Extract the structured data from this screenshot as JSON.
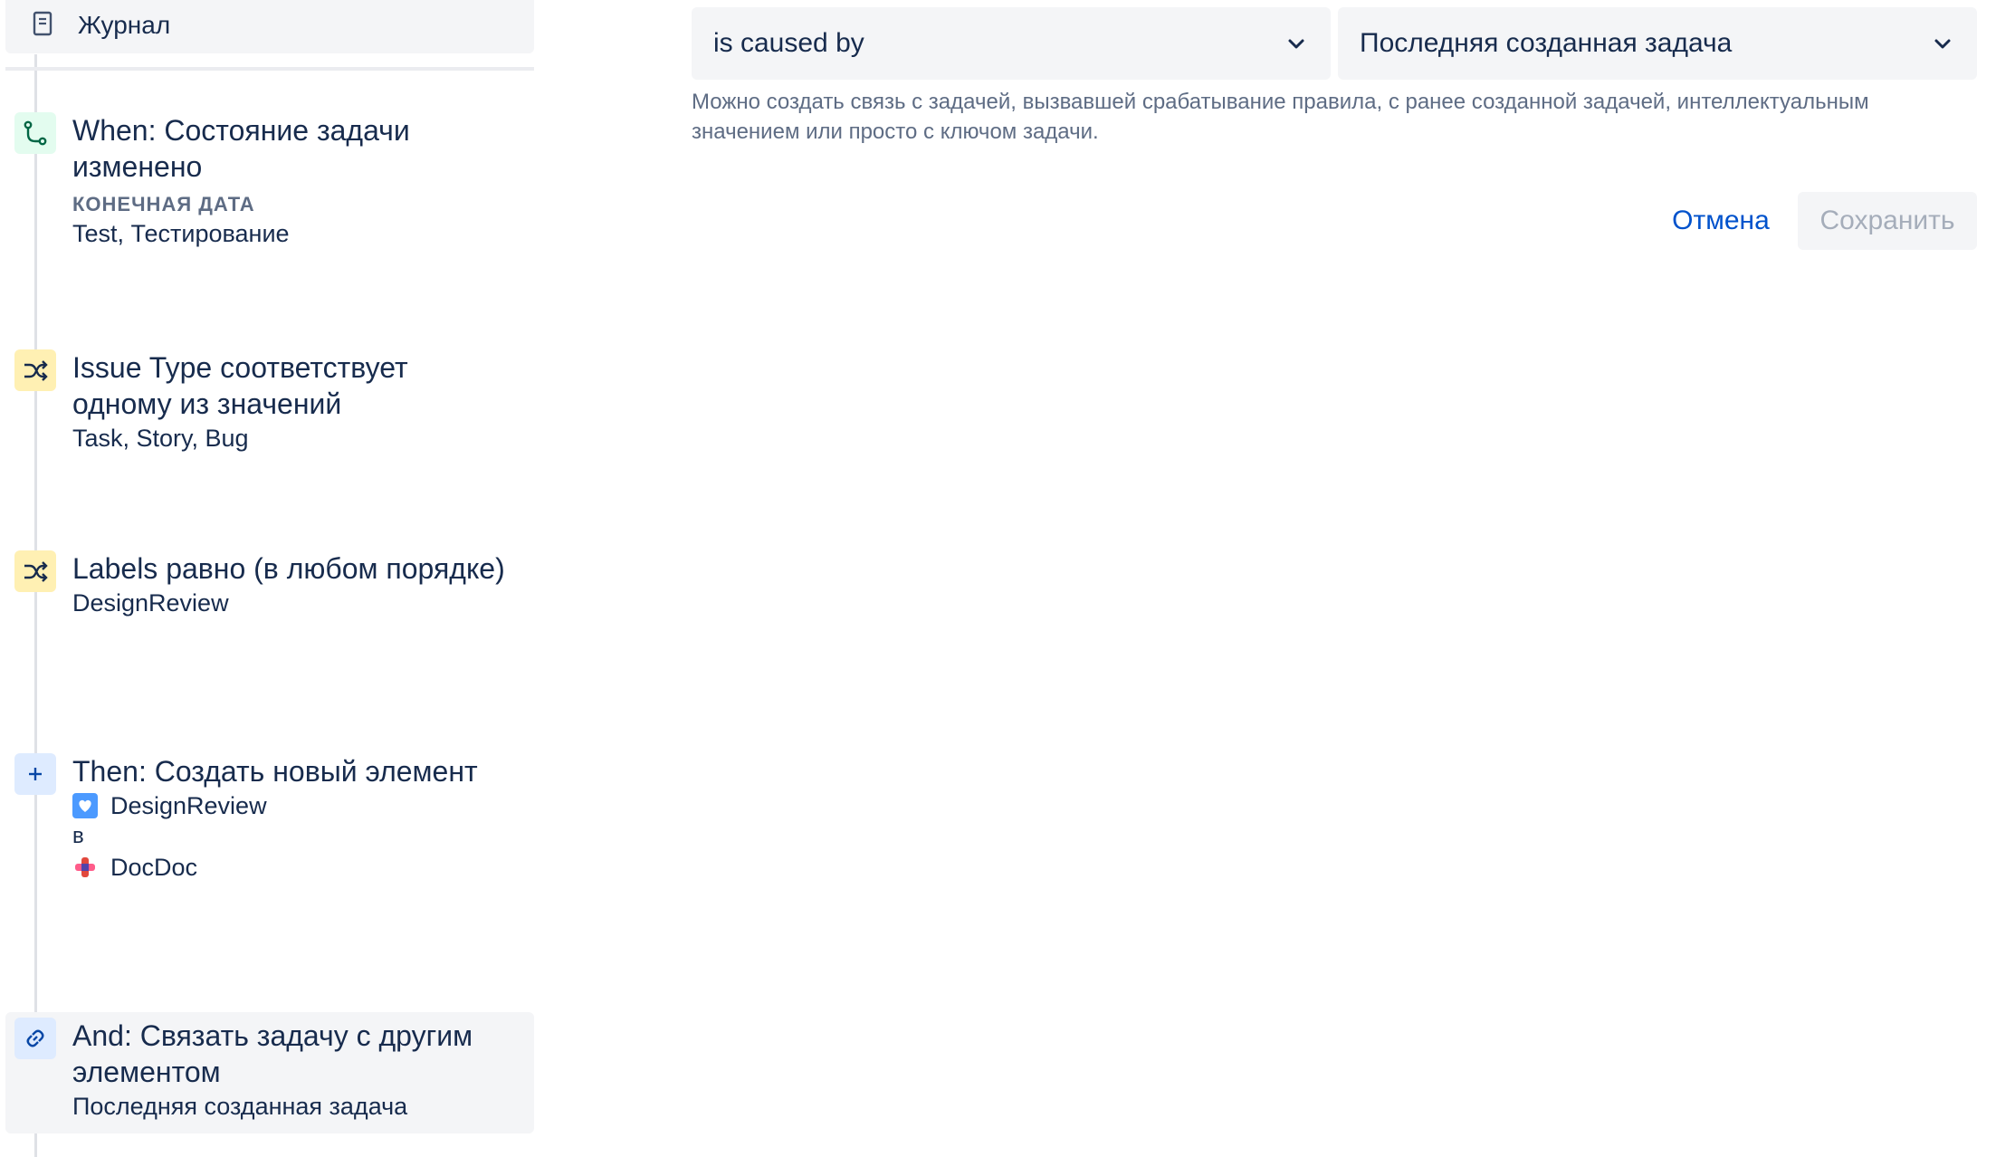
{
  "journal": {
    "label": "Журнал",
    "icon": "journal-icon"
  },
  "steps": [
    {
      "kind": "trigger",
      "icon": "branch-icon",
      "title": "When: Состояние задачи изменено",
      "meta": "КОНЕЧНАЯ ДАТА",
      "detail": "Test, Тестирование"
    },
    {
      "kind": "condition",
      "icon": "shuffle-icon",
      "title": "Issue Type соответствует одному из значений",
      "detail": "Task, Story, Bug"
    },
    {
      "kind": "condition",
      "icon": "shuffle-icon",
      "title": "Labels равно (в любом порядке)",
      "detail": "DesignReview"
    },
    {
      "kind": "action",
      "icon": "plus-icon",
      "title": "Then: Создать новый элемент",
      "issue_type": "DesignReview",
      "issue_type_icon": "heart-issue-type-icon",
      "connector": "в",
      "project": "DocDoc",
      "project_icon": "project-avatar-icon"
    },
    {
      "kind": "action",
      "icon": "link-icon",
      "title": "And: Связать задачу с другим элементом",
      "detail": "Последняя созданная задача"
    }
  ],
  "config": {
    "link_type_value": "is caused by",
    "target_value": "Последняя созданная задача",
    "helper": "Можно создать связь с задачей, вызвавшей срабатывание правила, с ранее созданной задачей, интеллектуальным значением или просто с ключом задачи.",
    "cancel_label": "Отмена",
    "save_label": "Сохранить"
  },
  "colors": {
    "link_blue": "#0052cc",
    "text_primary": "#172b4d",
    "text_subtle": "#5e6c84",
    "field_bg": "#f4f5f7",
    "trigger_bg": "#e3fcef",
    "condition_bg": "#fff0b3",
    "action_bg": "#deebff"
  }
}
